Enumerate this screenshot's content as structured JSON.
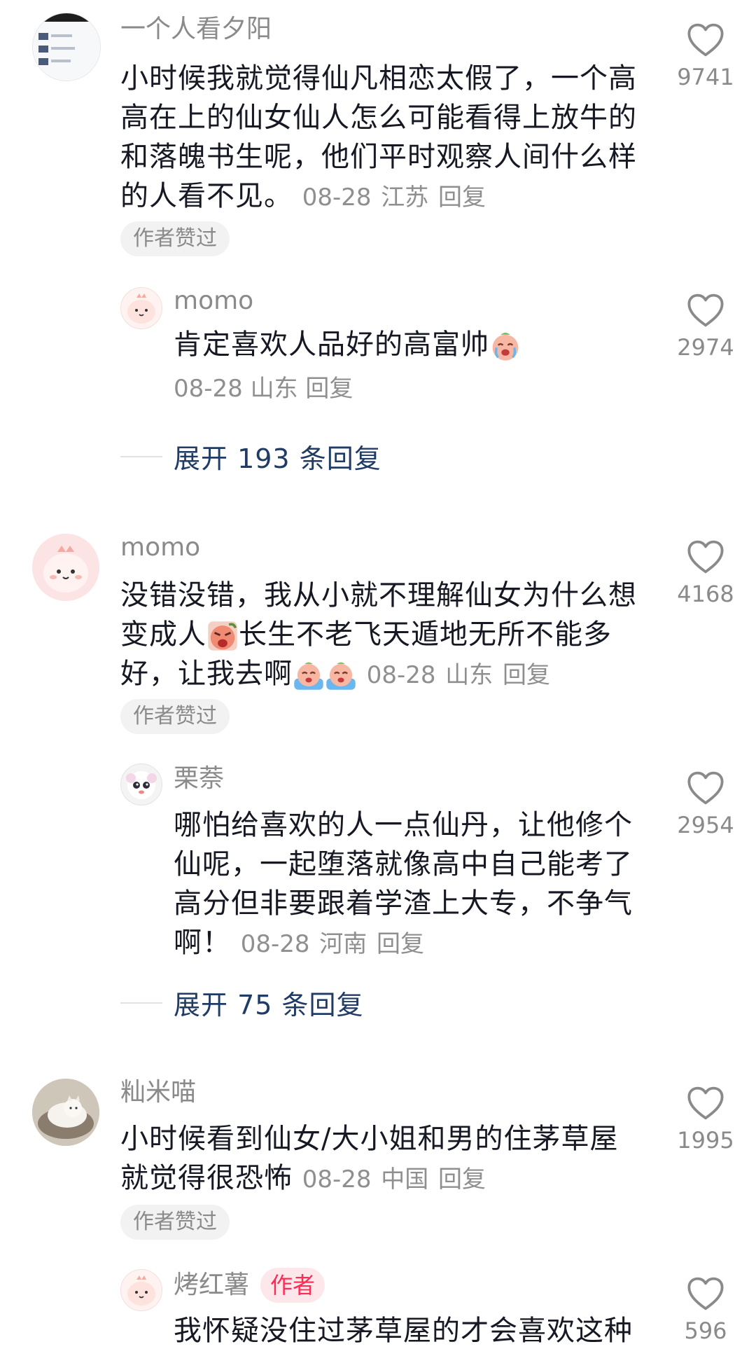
{
  "comments": [
    {
      "user": "一个人看夕阳",
      "text": "小时候我就觉得仙凡相恋太假了，一个高高在上的仙女仙人怎么可能看得上放牛的和落魄书生呢，他们平时观察人间什么样的人看不见。",
      "date": "08-28",
      "location": "江苏",
      "reply": "回复",
      "liked_badge": "作者赞过",
      "likes": "9741",
      "replies": [
        {
          "user": "momo",
          "text": "肯定喜欢人品好的高富帅",
          "date": "08-28",
          "location": "山东",
          "reply": "回复",
          "likes": "2974"
        }
      ],
      "expand_label": "展开 193 条回复"
    },
    {
      "user": "momo",
      "text_a": "没错没错，我从小就不理解仙女为什么想变成人",
      "text_b": "长生不老飞天遁地无所不能多好，让我去啊",
      "date": "08-28",
      "location": "山东",
      "reply": "回复",
      "liked_badge": "作者赞过",
      "likes": "4168",
      "replies": [
        {
          "user": "栗萘",
          "text": "哪怕给喜欢的人一点仙丹，让他修个仙呢，一起堕落就像高中自己能考了高分但非要跟着学渣上大专，不争气啊！",
          "date": "08-28",
          "location": "河南",
          "reply": "回复",
          "likes": "2954"
        }
      ],
      "expand_label": "展开 75 条回复"
    },
    {
      "user": "籼米喵",
      "text": "小时候看到仙女/大小姐和男的住茅草屋就觉得很恐怖",
      "date": "08-28",
      "location": "中国",
      "reply": "回复",
      "liked_badge": "作者赞过",
      "likes": "1995",
      "replies": [
        {
          "user": "烤红薯",
          "author_badge": "作者",
          "text": "我怀疑没住过茅草屋的才会喜欢这种",
          "likes": "596"
        }
      ]
    }
  ],
  "icons": {
    "like": "heart-outline-icon",
    "emoji_cry": "crying-face-emoji",
    "emoji_angry": "angry-face-emoji",
    "emoji_sob": "sobbing-face-emoji"
  },
  "colors": {
    "text": "#161823",
    "meta": "#8f8f8f",
    "expand": "#1f3b66",
    "author_badge_text": "#fe2c55",
    "author_badge_bg": "#fde7ea"
  }
}
